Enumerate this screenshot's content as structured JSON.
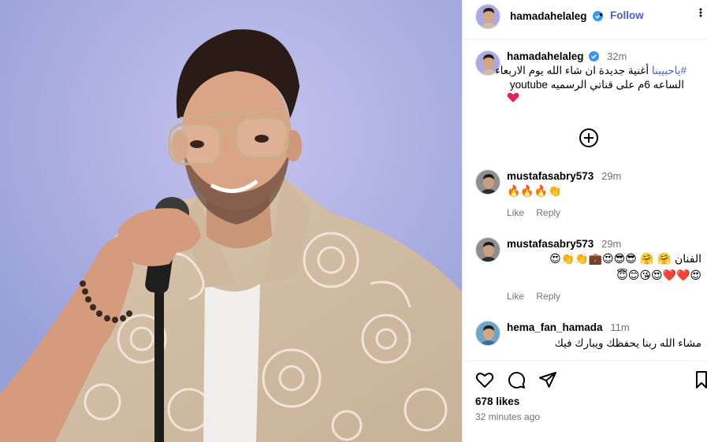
{
  "post": {
    "username": "hamadahelaleg",
    "follow_label": "Follow",
    "more_label": "•••",
    "caption": {
      "time": "32m",
      "line1_hashtag": "#",
      "line1_tag_text": "ياحبيبنا",
      "line1_text": "أغنية جديدة ان شاء الله يوم الاربعاء",
      "line2_text": "الساعه 6م على قناتي الرسميه youtube",
      "line3_text": "❤️"
    },
    "load_more_label": "Load more comments",
    "comments": [
      {
        "username": "mustafasabry573",
        "time": "29m",
        "lines": [
          "🔥🔥🔥👏"
        ],
        "like_label": "Like",
        "reply_label": "Reply"
      },
      {
        "username": "mustafasabry573",
        "time": "29m",
        "lines": [
          "الفنان 🤗 🤗 😎😎😍💼👏👏😍",
          "😍❤️❤️😍😘😊😇"
        ],
        "like_label": "Like",
        "reply_label": "Reply"
      },
      {
        "username": "hema_fan_hamada",
        "time": "11m",
        "lines": [
          "مشاء الله ربنا يحفظك ويبارك فيك"
        ],
        "like_label": "",
        "reply_label": ""
      }
    ],
    "likes": "678 likes",
    "posted": "32 minutes ago"
  },
  "icons": {
    "like": "heart-icon",
    "comment": "comment-icon",
    "share": "share-icon",
    "save": "bookmark-icon",
    "verified": "verified-badge-icon",
    "add_comment": "plus-circle-icon"
  },
  "colors": {
    "accent": "#4a5de0",
    "photo_bg": "#a7a9df",
    "muted": "#737373",
    "heart": "#e0245e"
  }
}
